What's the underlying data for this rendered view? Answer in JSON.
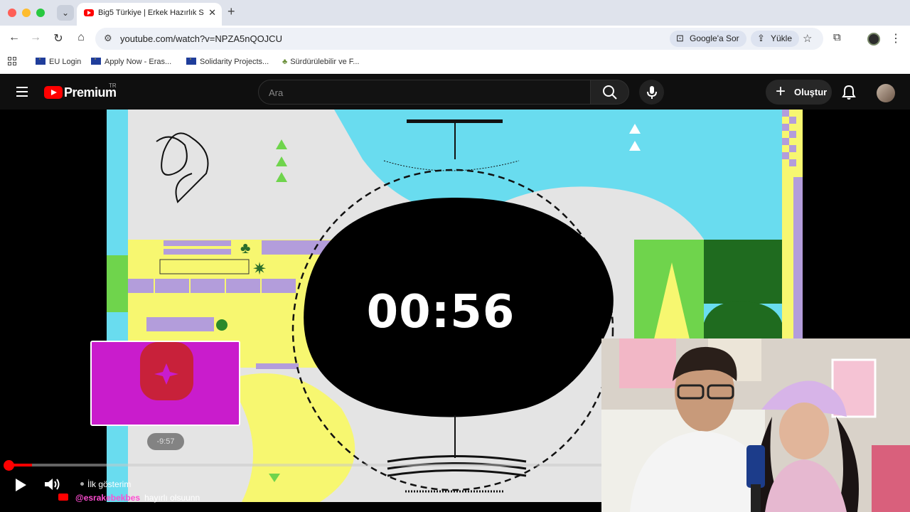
{
  "browser": {
    "tab_title": "Big5 Türkiye | Erkek Hazırlık S",
    "tab_close": "✕",
    "new_tab": "+",
    "url": "youtube.com/watch?v=NPZA5nQOJCU",
    "chip_ask_google": "Google'a Sor",
    "chip_upload": "Yükle",
    "bookmarks": [
      "EU Login",
      "Apply Now - Eras...",
      "Solidarity Projects...",
      "Sürdürülebilir ve F..."
    ]
  },
  "youtube": {
    "brand": "Premium",
    "region": "TR",
    "search_placeholder": "Ara",
    "create_label": "Oluştur"
  },
  "video": {
    "timer": "00:56",
    "pip_time": "-9:57",
    "progress": 0.04,
    "live_label": "İlk gösterim",
    "chat": {
      "user": "@esrakebekbes",
      "message": "hayırlı olsuunn"
    }
  },
  "colors": {
    "youtube_red": "#ff0000",
    "video_cyan": "#69dcef",
    "video_yellow": "#f7f770",
    "video_lavender": "#b39ddb",
    "video_green": "#6fd44c"
  }
}
